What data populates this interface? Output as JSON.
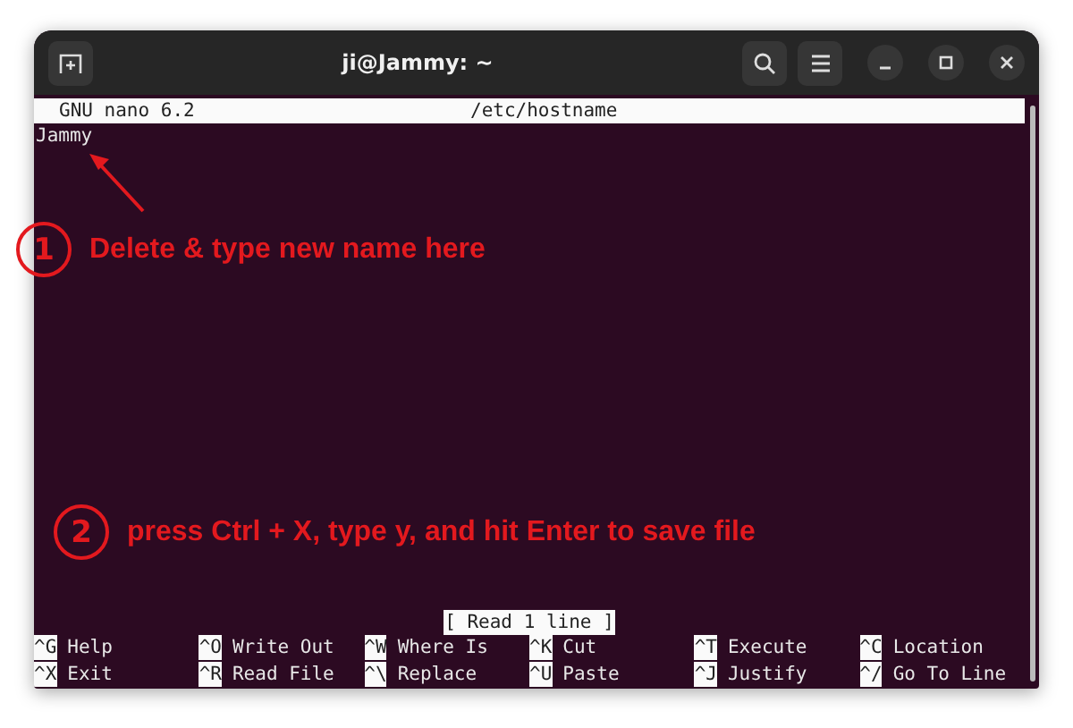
{
  "window": {
    "title": "ji@Jammy: ~"
  },
  "nano": {
    "header_left": "GNU nano 6.2",
    "header_file": "/etc/hostname",
    "lines": [
      "Jammy"
    ],
    "status": "[ Read 1 line ]",
    "shortcuts": [
      [
        {
          "key": "^G",
          "label": "Help"
        },
        {
          "key": "^O",
          "label": "Write Out"
        },
        {
          "key": "^W",
          "label": "Where Is"
        },
        {
          "key": "^K",
          "label": "Cut"
        },
        {
          "key": "^T",
          "label": "Execute"
        },
        {
          "key": "^C",
          "label": "Location"
        }
      ],
      [
        {
          "key": "^X",
          "label": "Exit"
        },
        {
          "key": "^R",
          "label": "Read File"
        },
        {
          "key": "^\\",
          "label": "Replace"
        },
        {
          "key": "^U",
          "label": "Paste"
        },
        {
          "key": "^J",
          "label": "Justify"
        },
        {
          "key": "^/",
          "label": "Go To Line"
        }
      ]
    ]
  },
  "annotations": [
    {
      "number": "1",
      "text": "Delete & type new name here"
    },
    {
      "number": "2",
      "text": "press Ctrl + X, type y, and hit Enter to save file"
    }
  ]
}
